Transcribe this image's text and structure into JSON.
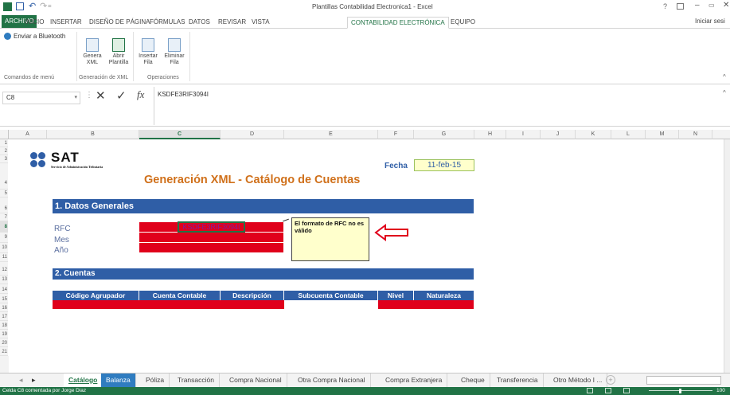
{
  "window": {
    "title": "Plantillas Contabilidad Electronica1 - Excel",
    "help": "?",
    "sign_in": "Iniciar sesi"
  },
  "ribbon_tabs": [
    "ARCHIVO",
    "INICIO",
    "INSERTAR",
    "DISEÑO DE PÁGINA",
    "FÓRMULAS",
    "DATOS",
    "REVISAR",
    "VISTA",
    "CONTABILIDAD ELECTRÓNICA",
    "EQUIPO"
  ],
  "ribbon": {
    "bluetooth_label": "Enviar a Bluetooth",
    "genera_xml": [
      "Genera",
      "XML"
    ],
    "abrir_plantilla": [
      "Abrir",
      "Plantilla"
    ],
    "insertar_fila": [
      "Insertar",
      "Fila"
    ],
    "eliminar_fila": [
      "Eliminar",
      "Fila"
    ],
    "groups": [
      "Comandos de menú",
      "Generación de XML",
      "Operaciones"
    ]
  },
  "formula_bar": {
    "name_box": "C8",
    "formula": "KSDFE3RIF3094I",
    "fx": "fx"
  },
  "columns": [
    "A",
    "B",
    "C",
    "D",
    "E",
    "F",
    "G",
    "H",
    "I",
    "J",
    "K",
    "L",
    "M",
    "N"
  ],
  "rows": [
    "1",
    "2",
    "3",
    "4",
    "5",
    "6",
    "7",
    "8",
    "9",
    "10",
    "11",
    "12",
    "13",
    "14",
    "15",
    "16",
    "17",
    "18",
    "19",
    "20",
    "21"
  ],
  "sheet": {
    "logo_text": "SAT",
    "logo_sub": "Servicio de Administración Tributaria",
    "title": "Generación XML - Catálogo de Cuentas",
    "fecha_label": "Fecha",
    "fecha_value": "11-feb-15",
    "section1": "1. Datos Generales",
    "rfc_label": "RFC",
    "mes_label": "Mes",
    "anio_label": "Año",
    "rfc_value": "KSDFE3RIF3094I",
    "comment": "El formato de RFC no es válido",
    "section2": "2. Cuentas",
    "table_headers": [
      "Código Agrupador",
      "Cuenta Contable",
      "Descripción",
      "Subcuenta Contable",
      "Nivel",
      "Naturaleza"
    ]
  },
  "sheet_tabs": [
    "Catálogo",
    "Balanza",
    "Póliza",
    "Transacción",
    "Compra Nacional",
    "Otra Compra Nacional",
    "Compra Extranjera",
    "Cheque",
    "Transferencia",
    "Otro Método I ..."
  ],
  "status": {
    "text": "Celda C8 comentada por Jorge Diaz",
    "zoom": "100"
  },
  "colors": {
    "excel_green": "#217346",
    "header_blue": "#2f5ea6",
    "required_red": "#e0001b",
    "title_orange": "#d0701a",
    "comment_bg": "#ffffcc"
  }
}
